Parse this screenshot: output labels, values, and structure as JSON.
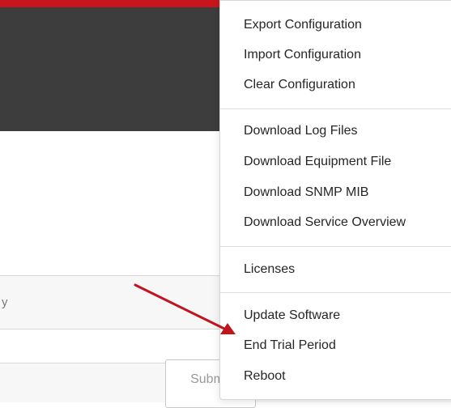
{
  "background": {
    "field_label": "y",
    "submit_label": "Submit"
  },
  "menu": {
    "groups": [
      {
        "items": [
          {
            "label": "Export Configuration"
          },
          {
            "label": "Import Configuration"
          },
          {
            "label": "Clear Configuration"
          }
        ]
      },
      {
        "items": [
          {
            "label": "Download Log Files"
          },
          {
            "label": "Download Equipment File"
          },
          {
            "label": "Download SNMP MIB"
          },
          {
            "label": "Download Service Overview"
          }
        ]
      },
      {
        "items": [
          {
            "label": "Licenses"
          }
        ]
      },
      {
        "items": [
          {
            "label": "Update Software"
          },
          {
            "label": "End Trial Period"
          },
          {
            "label": "Reboot"
          }
        ]
      }
    ]
  },
  "annotation": {
    "arrow_color": "#c0151d",
    "points_to": "End Trial Period"
  },
  "colors": {
    "accent": "#c8151d",
    "header": "#3d3d3d"
  }
}
